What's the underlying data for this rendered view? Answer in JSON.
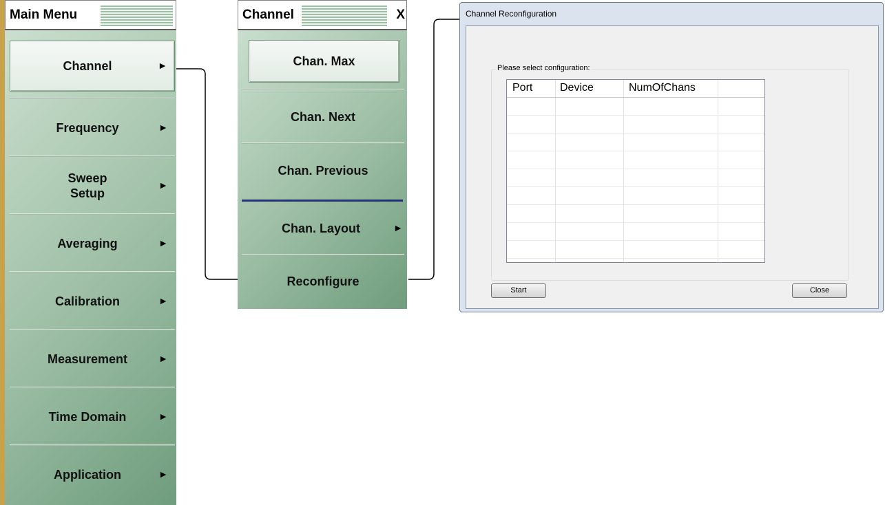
{
  "main_menu": {
    "title": "Main Menu",
    "items": [
      {
        "label": "Channel",
        "arrow": "►"
      },
      {
        "label": "Frequency",
        "arrow": "►"
      },
      {
        "label": "Sweep\nSetup",
        "arrow": "►"
      },
      {
        "label": "Averaging",
        "arrow": "►"
      },
      {
        "label": "Calibration",
        "arrow": "►"
      },
      {
        "label": "Measurement",
        "arrow": "►"
      },
      {
        "label": "Time Domain",
        "arrow": "►"
      },
      {
        "label": "Application",
        "arrow": "►"
      }
    ]
  },
  "channel_menu": {
    "title": "Channel",
    "close": "X",
    "items": [
      {
        "label": "Chan. Max"
      },
      {
        "label": "Chan. Next"
      },
      {
        "label": "Chan. Previous"
      },
      {
        "label": "Chan. Layout",
        "arrow": "►"
      },
      {
        "label": "Reconfigure"
      }
    ]
  },
  "dialog": {
    "title": "Channel Reconfiguration",
    "group_label": "Please select configuration:",
    "columns": [
      "Port",
      "Device",
      "NumOfChans"
    ],
    "rows": [],
    "start_label": "Start",
    "close_label": "Close"
  },
  "colors": {
    "menu_green_light": "#cfe2d3",
    "menu_green_dark": "#6f9d7d",
    "menu_edge_gold": "#c8a24a",
    "divider_blue": "#22307a",
    "dialog_frame": "#dbe4ee"
  }
}
